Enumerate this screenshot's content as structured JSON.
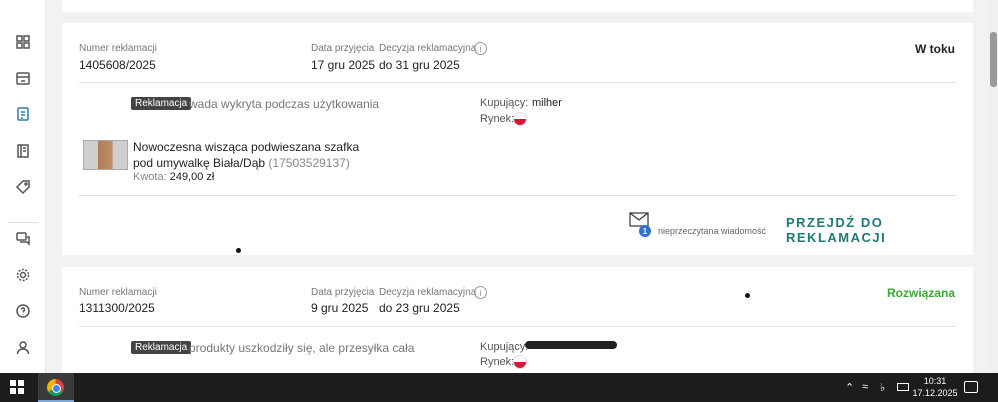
{
  "claims": [
    {
      "claim_number_label": "Numer reklamacji",
      "claim_number": "1405608/2025",
      "received_label": "Data przyjęcia",
      "received_date": "17 gru 2025",
      "decision_label": "Decyzja reklamacyjna",
      "decision_date": "do 31 gru 2025",
      "status": "W toku",
      "status_color": "#222222",
      "type_badge": "Reklamacja",
      "reason": "wada wykryta podczas użytkowania",
      "buyer_label": "Kupujący:",
      "buyer": "milher",
      "market_label": "Rynek:",
      "product_name": "Nowoczesna wisząca podwieszana szafka pod umywalkę Biała/Dąb",
      "product_id": "(17503529137)",
      "amount_label": "Kwota:",
      "amount": "249,00 zł",
      "unread_count": "1",
      "unread_text": "nieprzeczytana wiadomość",
      "cta": "PRZEJDŹ DO REKLAMACJI"
    },
    {
      "claim_number_label": "Numer reklamacji",
      "claim_number": "1311300/2025",
      "received_label": "Data przyjęcia",
      "received_date": "9 gru 2025",
      "decision_label": "Decyzja reklamacyjna",
      "decision_date": "do 23 gru 2025",
      "status": "Rozwiązana",
      "status_color": "#3aa935",
      "type_badge": "Reklamacja",
      "reason": "produkty uszkodziły się, ale przesyłka cała",
      "buyer_label": "Kupujący:",
      "market_label": "Rynek:"
    }
  ],
  "taskbar": {
    "time": "10:31",
    "date": "17.12.2025"
  }
}
